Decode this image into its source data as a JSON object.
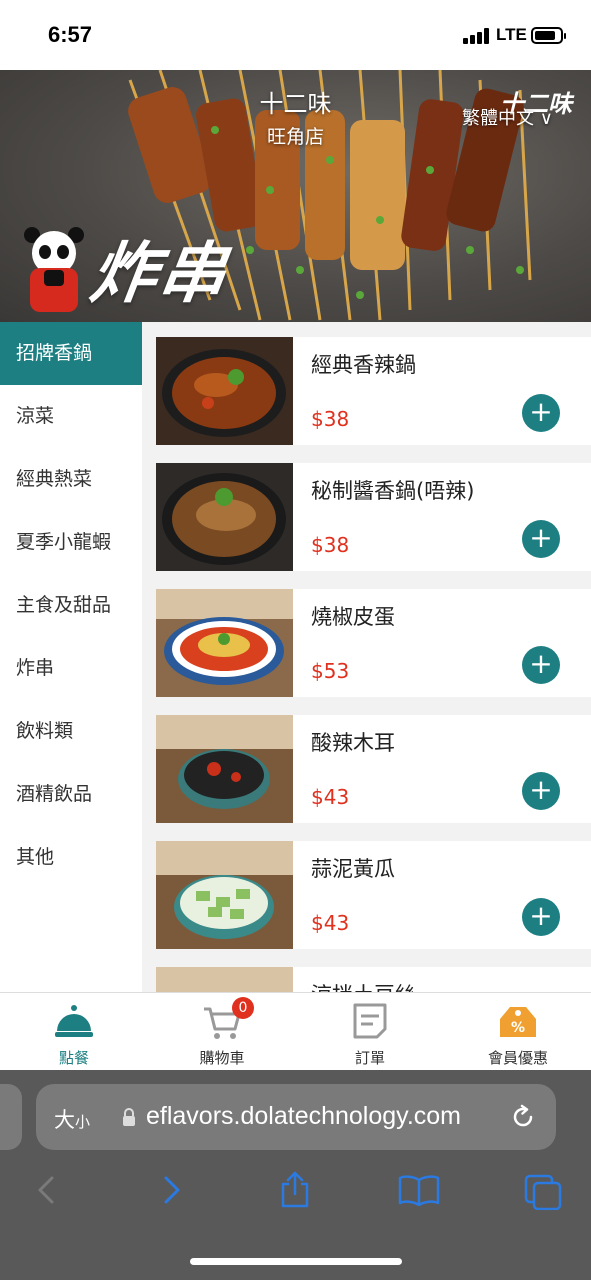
{
  "status": {
    "time": "6:57",
    "network": "LTE",
    "battery_level": 0.85
  },
  "header": {
    "store_name": "十二味",
    "branch": "旺角店",
    "language": "繁體中文 ∨",
    "brand_mark": "十二味",
    "banner_text": "炸串"
  },
  "sidebar": {
    "categories": [
      {
        "label": "招牌香鍋",
        "active": true
      },
      {
        "label": "涼菜"
      },
      {
        "label": "經典熱菜"
      },
      {
        "label": "夏季小龍蝦"
      },
      {
        "label": "主食及甜品"
      },
      {
        "label": "炸串"
      },
      {
        "label": "飲料類"
      },
      {
        "label": "酒精飲品"
      },
      {
        "label": "其他"
      }
    ]
  },
  "menu": {
    "items": [
      {
        "name": "經典香辣鍋",
        "price": "$38"
      },
      {
        "name": "秘制醬香鍋(唔辣)",
        "price": "$38"
      },
      {
        "name": "燒椒皮蛋",
        "price": "$53"
      },
      {
        "name": "酸辣木耳",
        "price": "$43"
      },
      {
        "name": "蒜泥黃瓜",
        "price": "$43"
      },
      {
        "name": "涼拌土豆絲",
        "price": ""
      }
    ],
    "add_symbol": "+"
  },
  "tabbar": {
    "tabs": [
      {
        "label": "點餐",
        "icon": "cloche-icon",
        "active": true
      },
      {
        "label": "購物車",
        "icon": "cart-icon",
        "badge": "0"
      },
      {
        "label": "訂單",
        "icon": "order-icon"
      },
      {
        "label": "會員優惠",
        "icon": "discount-tag-icon"
      }
    ]
  },
  "browser": {
    "text_size": "大",
    "text_size_small": "小",
    "url": "eflavors.dolatechnology.com"
  },
  "colors": {
    "accent": "#1e7f82",
    "price": "#e0301e",
    "badge": "#e0301e",
    "tag_orange": "#f0a030"
  }
}
